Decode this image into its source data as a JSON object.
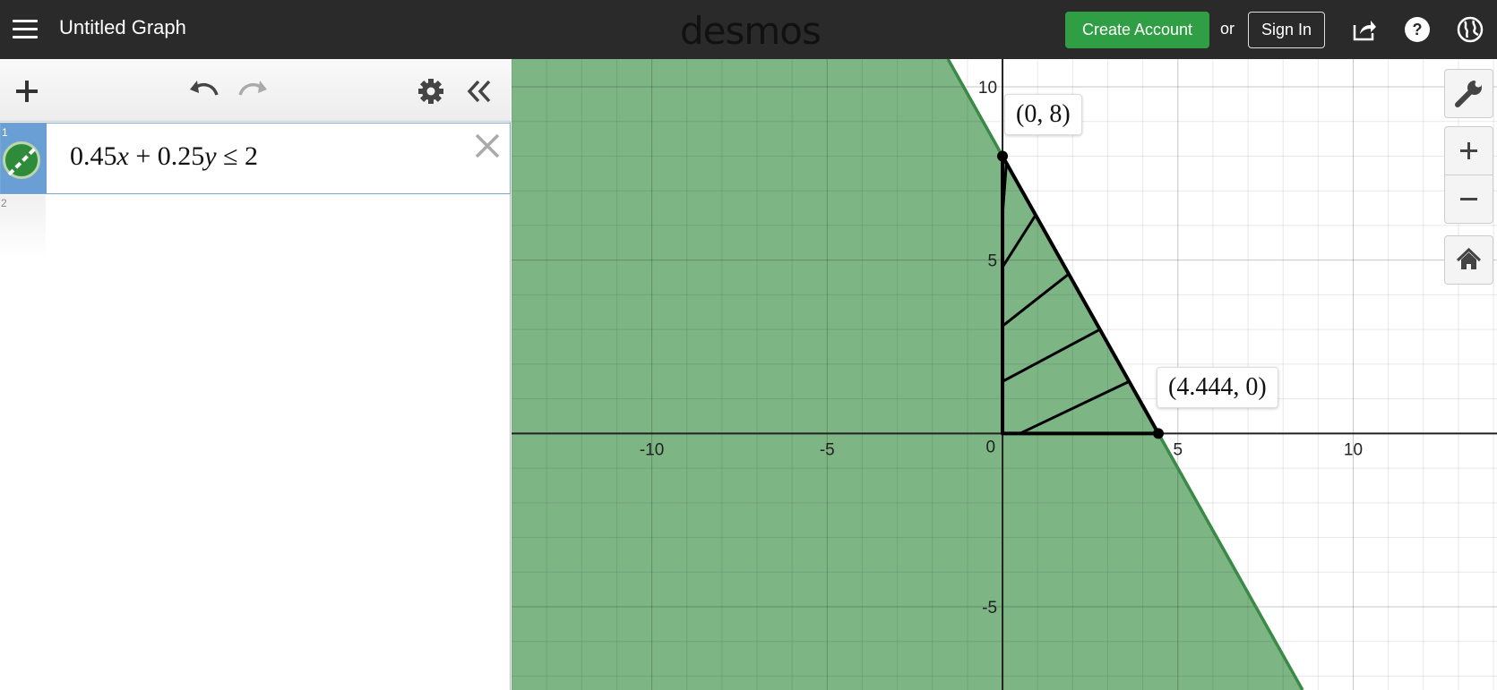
{
  "topbar": {
    "graph_title": "Untitled Graph",
    "logo": "desmos",
    "create_account_label": "Create Account",
    "or_text": "or",
    "sign_in_label": "Sign In",
    "icons": [
      "share-icon",
      "help-icon",
      "language-globe-icon"
    ]
  },
  "colors": {
    "topbar": "#2a2a2a",
    "accent_green": "#2f9e44",
    "shade": "#7db585",
    "boundary": "#3a8a45",
    "selected_row": "#6a9fd6"
  },
  "toolbar": {
    "icons": [
      "add-icon",
      "undo-icon",
      "redo-icon",
      "settings-gear-icon",
      "collapse-panel-icon"
    ]
  },
  "expressions": [
    {
      "index": "1",
      "latex_display": "0.45x + 0.25y ≤ 2",
      "coef_x": "0.45",
      "var_x": "x",
      "coef_y": "0.25",
      "var_y": "y",
      "relation": "≤",
      "rhs": "2",
      "color": "#2e8b3a"
    },
    {
      "index": "2",
      "latex_display": ""
    }
  ],
  "graph": {
    "x_ticks": [
      "-10",
      "-5",
      "5",
      "10"
    ],
    "y_ticks": [
      "10",
      "5",
      "-5"
    ],
    "origin_label": "0",
    "x_range": [
      -14,
      14.1
    ],
    "y_range": [
      -7.4,
      10.8
    ],
    "inequality": {
      "a": 0.45,
      "b": 0.25,
      "c": 2,
      "relation": "<="
    },
    "points": [
      {
        "x": 0,
        "y": 8,
        "label": "(0, 8)"
      },
      {
        "x": 4.444,
        "y": 0,
        "label": "(4.444, 0)"
      }
    ]
  },
  "controls": {
    "wrench_icon": "wrench-icon",
    "zoom_in_icon": "zoom-in-icon",
    "zoom_out_icon": "zoom-out-icon",
    "home_icon": "home-icon"
  }
}
